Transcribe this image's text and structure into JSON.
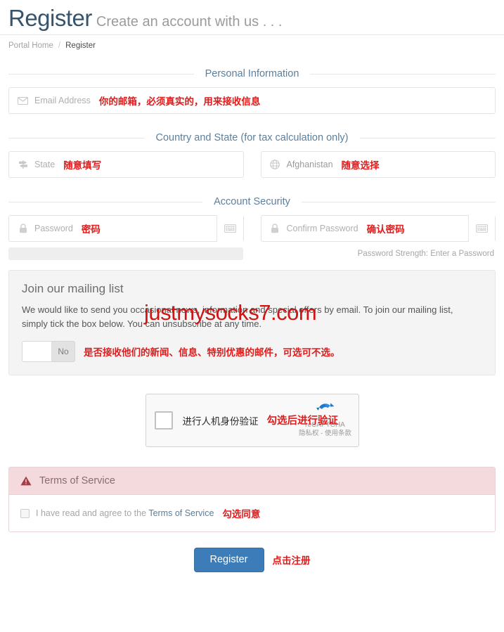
{
  "header": {
    "title": "Register",
    "subtitle": "Create an account with us . . ."
  },
  "breadcrumb": {
    "home": "Portal Home",
    "separator": "/",
    "current": "Register"
  },
  "watermark": "justmysocks7.com",
  "sections": {
    "personal": {
      "legend": "Personal Information",
      "email": {
        "icon": "envelope-icon",
        "placeholder": "Email Address",
        "value": "",
        "annotation": "你的邮箱，必须真实的，用来接收信息"
      }
    },
    "country_state": {
      "legend": "Country and State (for tax calculation only)",
      "state": {
        "icon": "map-signs-icon",
        "placeholder": "State",
        "value": "",
        "annotation": "随意填写"
      },
      "country": {
        "icon": "globe-icon",
        "selected": "Afghanistan",
        "annotation": "随意选择"
      }
    },
    "account_security": {
      "legend": "Account Security",
      "password": {
        "icon": "lock-icon",
        "placeholder": "Password",
        "value": "",
        "addon_icon": "keyboard-icon",
        "annotation": "密码"
      },
      "confirm_password": {
        "icon": "lock-icon",
        "placeholder": "Confirm Password",
        "value": "",
        "addon_icon": "keyboard-icon",
        "annotation": "确认密码"
      },
      "strength": {
        "progress_percent": 0,
        "text": "Password Strength: Enter a Password"
      }
    }
  },
  "mailing_list": {
    "title": "Join our mailing list",
    "description": "We would like to send you occasional news, information and special offers by email. To join our mailing list, simply tick the box below. You can unsubscribe at any time.",
    "toggle": {
      "state_label": "No",
      "checked": false
    },
    "annotation": "是否接收他们的新闻、信息、特别优惠的邮件，可选可不选。"
  },
  "captcha": {
    "label": "进行人机身份验证",
    "checked": false,
    "brand_name": "reCAPTCHA",
    "brand_links": "隐私权 - 使用条款",
    "annotation": "勾选后进行验证"
  },
  "terms": {
    "panel_title": "Terms of Service",
    "warning_icon": "warning-triangle-icon",
    "checkbox_checked": false,
    "agree_text": "I have read and agree to the ",
    "link_text": "Terms of Service",
    "annotation": "勾选同意"
  },
  "submit": {
    "label": "Register",
    "annotation": "点击注册"
  },
  "colors": {
    "accent_blue": "#3b7cb9",
    "legend_blue": "#5b7f9e",
    "title_blue": "#36546d",
    "annotation_red": "#e01b1b",
    "watermark_red": "#d01414",
    "tos_pink": "#f5dadd"
  }
}
